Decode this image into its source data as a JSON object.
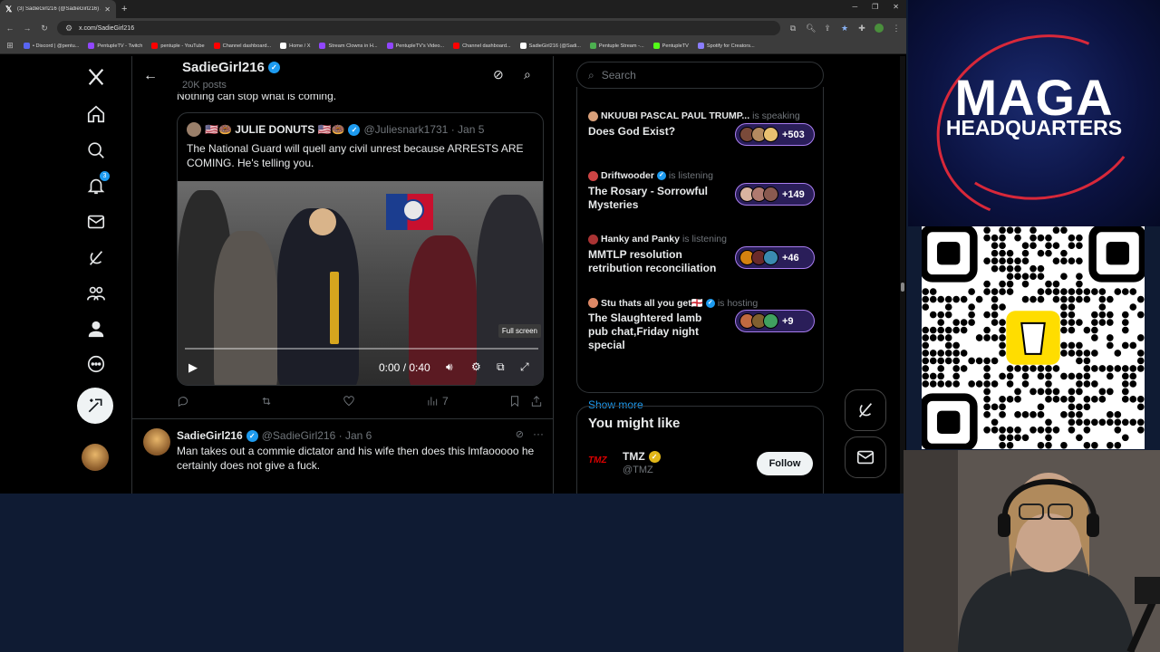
{
  "browser": {
    "tab_title": "(3) SadieGirl216 (@SadieGirl216) / X",
    "url": "x.com/SadieGirl216",
    "bookmarks": [
      {
        "label": "• Discord | @pentu...",
        "color": "#5865f2"
      },
      {
        "label": "PentupleTV - Twitch",
        "color": "#9146ff"
      },
      {
        "label": "pentuple - YouTube",
        "color": "#ff0000"
      },
      {
        "label": "Channel dashboard...",
        "color": "#ff0000"
      },
      {
        "label": "Home / X",
        "color": "#ffffff"
      },
      {
        "label": "Stream Clowns in H...",
        "color": "#9146ff"
      },
      {
        "label": "PentupleTV's Video...",
        "color": "#9146ff"
      },
      {
        "label": "Channel dashboard...",
        "color": "#ff0000"
      },
      {
        "label": "SadieGirl216 (@Sadi...",
        "color": "#ffffff"
      },
      {
        "label": "Pentuple Stream -...",
        "color": "#4caf50"
      },
      {
        "label": "PentupleTV",
        "color": "#53fc18"
      },
      {
        "label": "Spotify for Creators...",
        "color": "#8a7dff"
      }
    ]
  },
  "nav": {
    "notification_count": "3"
  },
  "header": {
    "name": "SadieGirl216",
    "post_count": "20K posts"
  },
  "post1": {
    "text": "Nothing can stop what is coming.",
    "quote": {
      "name": "🇺🇸🍩 JULIE DONUTS 🇺🇸🍩",
      "handle": "@Juliesnark1731 · Jan 5",
      "text": "The National Guard will quell any civil unrest because ARRESTS ARE COMING. He's telling you.",
      "video": {
        "time": "0:00 / 0:40",
        "tooltip": "Full screen"
      }
    },
    "views": "7"
  },
  "post2": {
    "name": "SadieGirl216",
    "handle": "@SadieGirl216 · Jan 6",
    "text": "Man takes out a commie dictator and his wife then does this lmfaooooo he certainly does not give a fuck."
  },
  "search": {
    "placeholder": "Search"
  },
  "spaces": [
    {
      "host": "NKUUBI PASCAL PAUL TRUMP...",
      "status": "is speaking",
      "title": "Does God Exist?",
      "count": "+503",
      "host_color": "#d8a07a"
    },
    {
      "host": "Driftwooder",
      "status": "is listening",
      "title": "The Rosary - Sorrowful Mysteries",
      "count": "+149",
      "host_color": "#c44",
      "verified": true
    },
    {
      "host": "Hanky and Panky",
      "status": "is listening",
      "title": "MMTLP resolution retribution reconciliation",
      "count": "+46",
      "host_color": "#a33"
    },
    {
      "host": "Stu thats all you get🏴󠁧󠁢󠁥󠁮󠁧󠁿",
      "status": "is hosting",
      "title": "The Slaughtered lamb pub chat,Friday night special",
      "count": "+9",
      "host_color": "#d86",
      "verified": true
    }
  ],
  "show_more": "Show more",
  "you_might_like": {
    "title": "You might like",
    "account_name": "TMZ",
    "account_handle": "@TMZ",
    "logo_text": "TMZ",
    "follow_label": "Follow"
  },
  "overlay": {
    "title": "MAGA",
    "subtitle": "HEADQUARTERS"
  },
  "colors": {
    "accent": "#1d9bf0",
    "spaces_pill": "#7856ff"
  }
}
